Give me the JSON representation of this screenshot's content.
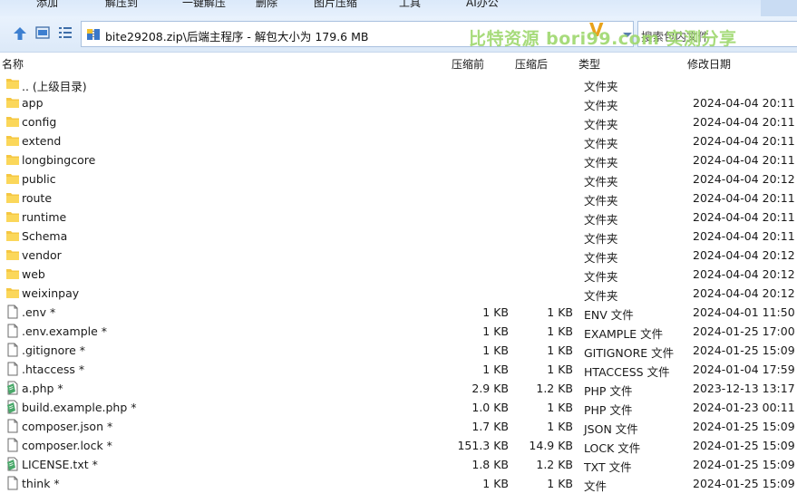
{
  "toolbar": {
    "items": [
      "添加",
      "解压到",
      "一键解压",
      "删除",
      "图片压缩",
      "工具",
      "AI办公"
    ]
  },
  "address": {
    "path": "bite29208.zip\\后端主程序 - 解包大小为 179.6 MB",
    "search_placeholder": "搜索包内文件",
    "logo": "V"
  },
  "watermark": "比特资源 bori99.com 实测分享",
  "columns": {
    "name": "名称",
    "compressed": "压缩前",
    "original": "压缩后",
    "type": "类型",
    "modified": "修改日期"
  },
  "files": [
    {
      "name": ".. (上级目录)",
      "comp": "",
      "orig": "",
      "type": "文件夹",
      "date": "",
      "icon": "folder-icon"
    },
    {
      "name": "app",
      "comp": "",
      "orig": "",
      "type": "文件夹",
      "date": "2024-04-04 20:11",
      "icon": "folder-icon"
    },
    {
      "name": "config",
      "comp": "",
      "orig": "",
      "type": "文件夹",
      "date": "2024-04-04 20:11",
      "icon": "folder-icon"
    },
    {
      "name": "extend",
      "comp": "",
      "orig": "",
      "type": "文件夹",
      "date": "2024-04-04 20:11",
      "icon": "folder-icon"
    },
    {
      "name": "longbingcore",
      "comp": "",
      "orig": "",
      "type": "文件夹",
      "date": "2024-04-04 20:11",
      "icon": "folder-icon"
    },
    {
      "name": "public",
      "comp": "",
      "orig": "",
      "type": "文件夹",
      "date": "2024-04-04 20:12",
      "icon": "folder-icon"
    },
    {
      "name": "route",
      "comp": "",
      "orig": "",
      "type": "文件夹",
      "date": "2024-04-04 20:11",
      "icon": "folder-icon"
    },
    {
      "name": "runtime",
      "comp": "",
      "orig": "",
      "type": "文件夹",
      "date": "2024-04-04 20:11",
      "icon": "folder-icon"
    },
    {
      "name": "Schema",
      "comp": "",
      "orig": "",
      "type": "文件夹",
      "date": "2024-04-04 20:11",
      "icon": "folder-icon"
    },
    {
      "name": "vendor",
      "comp": "",
      "orig": "",
      "type": "文件夹",
      "date": "2024-04-04 20:12",
      "icon": "folder-icon"
    },
    {
      "name": "web",
      "comp": "",
      "orig": "",
      "type": "文件夹",
      "date": "2024-04-04 20:12",
      "icon": "folder-icon"
    },
    {
      "name": "weixinpay",
      "comp": "",
      "orig": "",
      "type": "文件夹",
      "date": "2024-04-04 20:12",
      "icon": "folder-icon"
    },
    {
      "name": ".env *",
      "comp": "1 KB",
      "orig": "1 KB",
      "type": "ENV 文件",
      "date": "2024-04-01 11:50",
      "icon": "file-icon"
    },
    {
      "name": ".env.example *",
      "comp": "1 KB",
      "orig": "1 KB",
      "type": "EXAMPLE 文件",
      "date": "2024-01-25 17:00",
      "icon": "file-icon"
    },
    {
      "name": ".gitignore *",
      "comp": "1 KB",
      "orig": "1 KB",
      "type": "GITIGNORE 文件",
      "date": "2024-01-25 15:09",
      "icon": "file-icon"
    },
    {
      "name": ".htaccess *",
      "comp": "1 KB",
      "orig": "1 KB",
      "type": "HTACCESS 文件",
      "date": "2024-01-04 17:59",
      "icon": "file-icon"
    },
    {
      "name": "a.php *",
      "comp": "2.9 KB",
      "orig": "1.2 KB",
      "type": "PHP 文件",
      "date": "2023-12-13 13:17",
      "icon": "code-file-icon"
    },
    {
      "name": "build.example.php *",
      "comp": "1.0 KB",
      "orig": "1 KB",
      "type": "PHP 文件",
      "date": "2024-01-23 00:11",
      "icon": "code-file-icon"
    },
    {
      "name": "composer.json *",
      "comp": "1.7 KB",
      "orig": "1 KB",
      "type": "JSON 文件",
      "date": "2024-01-25 15:09",
      "icon": "file-icon"
    },
    {
      "name": "composer.lock *",
      "comp": "151.3 KB",
      "orig": "14.9 KB",
      "type": "LOCK 文件",
      "date": "2024-01-25 15:09",
      "icon": "file-icon"
    },
    {
      "name": "LICENSE.txt *",
      "comp": "1.8 KB",
      "orig": "1.2 KB",
      "type": "TXT 文件",
      "date": "2024-01-25 15:09",
      "icon": "code-file-icon"
    },
    {
      "name": "think *",
      "comp": "1 KB",
      "orig": "1 KB",
      "type": "文件",
      "date": "2024-01-25 15:09",
      "icon": "file-icon"
    }
  ]
}
